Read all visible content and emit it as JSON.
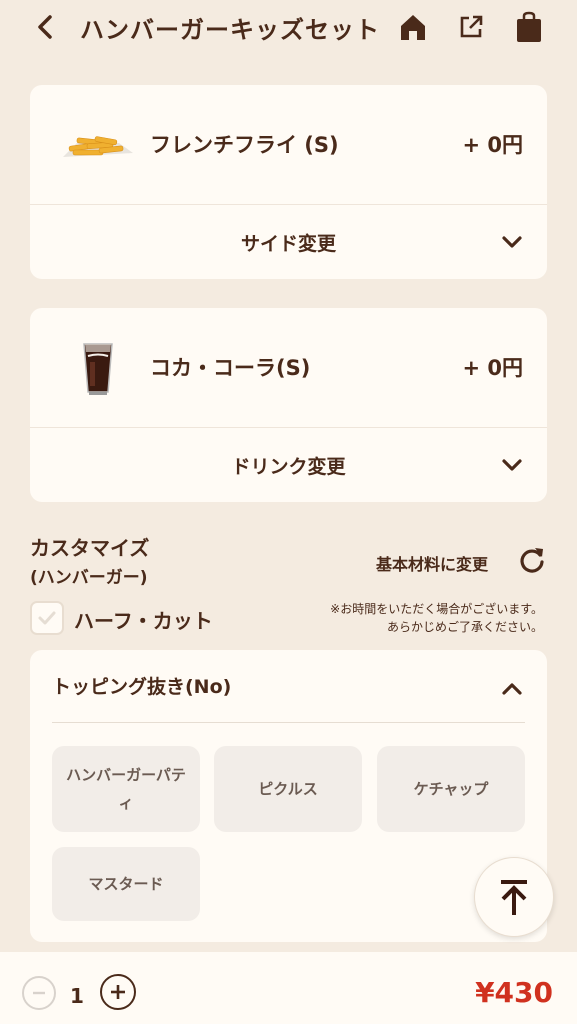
{
  "header": {
    "title": "ハンバーガーキッズセット",
    "back_icon": "chevron-left-icon",
    "home_icon": "home-icon",
    "share_icon": "external-link-icon",
    "bag_icon": "shopping-bag-icon"
  },
  "side": {
    "name": "フレンチフライ (S)",
    "price": "+ 0円",
    "change_label": "サイド変更"
  },
  "drink": {
    "name": "コカ・コーラ(S)",
    "price": "+ 0円",
    "change_label": "ドリンク変更"
  },
  "customize": {
    "title": "カスタマイズ",
    "subtitle": "(ハンバーガー)",
    "reset_label": "基本材料に変更",
    "half_cut_label": "ハーフ・カット",
    "half_cut_checked": false,
    "note_line1": "※お時間をいただく場合がございます。",
    "note_line2": "あらかじめご了承ください。"
  },
  "toppings": {
    "heading": "トッピング抜き(No)",
    "options": [
      {
        "label": "ハンバーガーパティ"
      },
      {
        "label": "ピクルス"
      },
      {
        "label": "ケチャップ"
      },
      {
        "label": "マスタード"
      }
    ]
  },
  "footer": {
    "quantity": "1",
    "total": "¥430"
  },
  "colors": {
    "background": "#f4ebe0",
    "card": "#fffbf5",
    "text": "#4a2a1a",
    "price_red": "#d0311f"
  }
}
